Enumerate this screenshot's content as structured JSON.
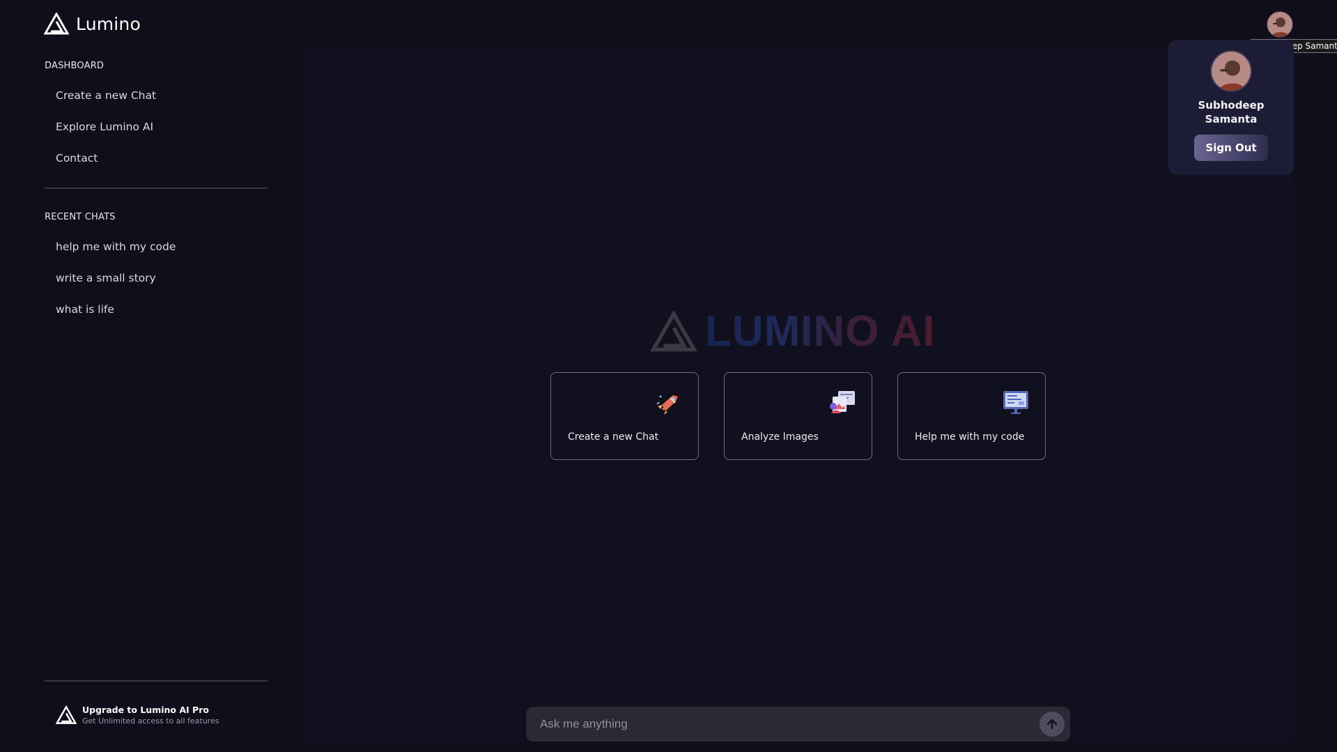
{
  "brand": {
    "name": "Lumino"
  },
  "sidebar": {
    "dashboard_title": "DASHBOARD",
    "dashboard_items": [
      {
        "label": "Create a new Chat"
      },
      {
        "label": "Explore Lumino AI"
      },
      {
        "label": "Contact"
      }
    ],
    "recent_title": "RECENT CHATS",
    "recent_items": [
      {
        "label": "help me with my code"
      },
      {
        "label": "write a small story"
      },
      {
        "label": "what is life"
      }
    ],
    "upgrade": {
      "title": "Upgrade to Lumino AI Pro",
      "subtitle": "Get Unlimited access to all features"
    }
  },
  "main": {
    "hero_text": "LUMINO AI",
    "cards": [
      {
        "label": "Create a new Chat",
        "icon": "rocket-icon"
      },
      {
        "label": "Analyze Images",
        "icon": "image-icon"
      },
      {
        "label": "Help me with my code",
        "icon": "code-monitor-icon"
      }
    ],
    "input": {
      "placeholder": "Ask me anything"
    }
  },
  "user": {
    "name": "Subhodeep Samanta",
    "tooltip": "Subhodeep Samanta",
    "signout_label": "Sign Out"
  },
  "colors": {
    "background": "#0f0e1a",
    "panel": "#11101e",
    "profile_card": "#1d1c36",
    "card_border": "#6e6e80",
    "input_bg": "#2a2a36"
  }
}
